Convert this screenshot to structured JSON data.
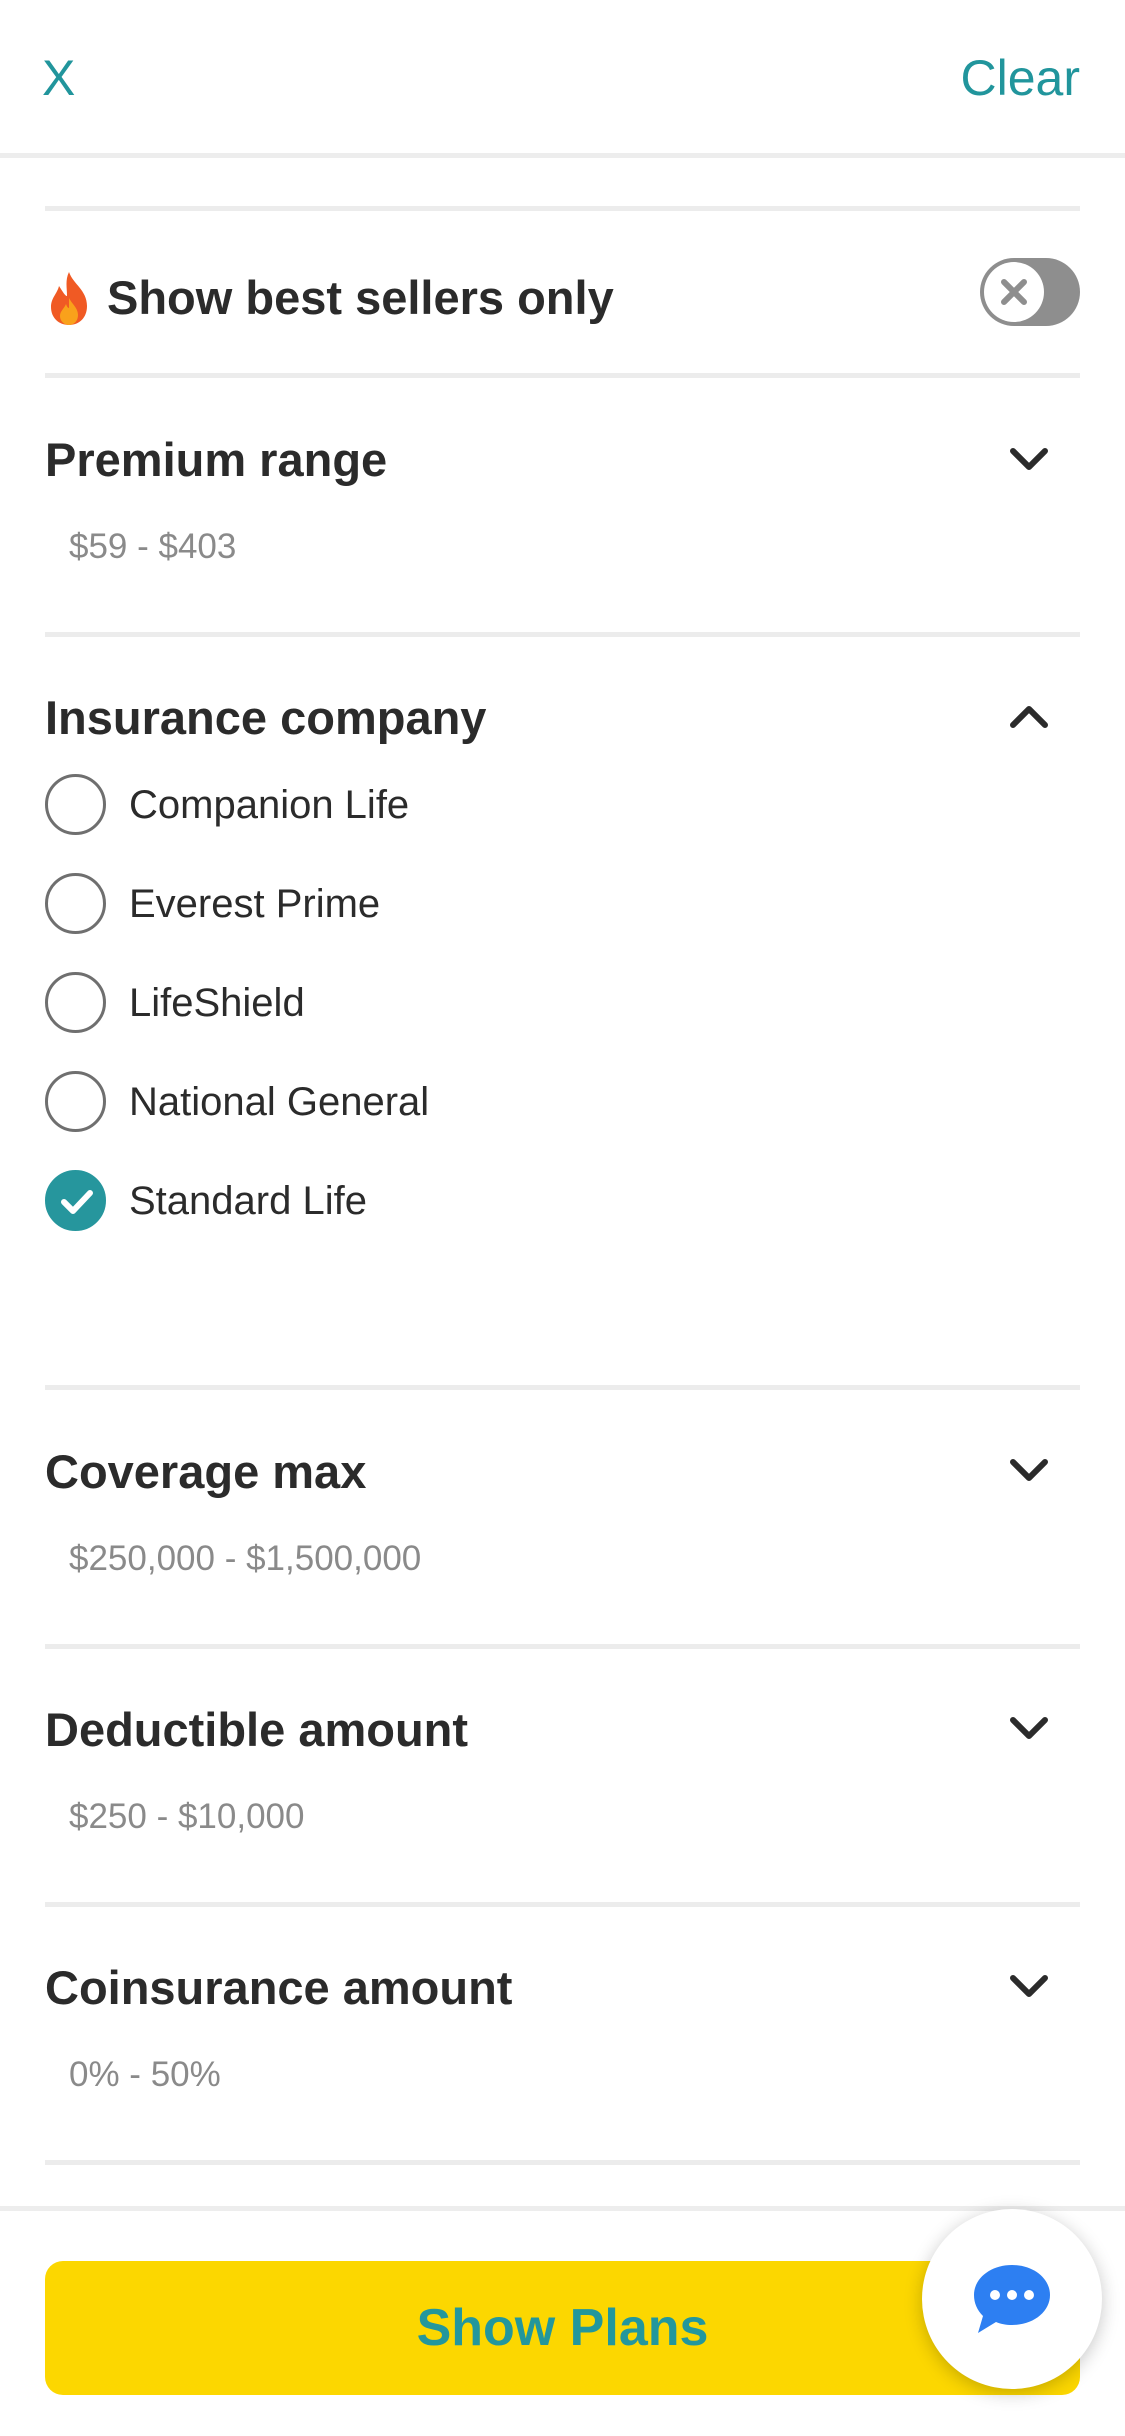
{
  "header": {
    "close_label": "X",
    "clear_label": "Clear"
  },
  "best_sellers": {
    "label": "Show best sellers only",
    "toggle_on": false
  },
  "sections": {
    "premium": {
      "title": "Premium range",
      "summary": "$59 - $403",
      "expanded": false
    },
    "insurance": {
      "title": "Insurance company",
      "expanded": true,
      "options": [
        {
          "label": "Companion Life",
          "checked": false
        },
        {
          "label": "Everest Prime",
          "checked": false
        },
        {
          "label": "LifeShield",
          "checked": false
        },
        {
          "label": "National General",
          "checked": false
        },
        {
          "label": "Standard Life",
          "checked": true
        }
      ]
    },
    "coverage": {
      "title": "Coverage max",
      "summary": "$250,000 - $1,500,000",
      "expanded": false
    },
    "deductible": {
      "title": "Deductible amount",
      "summary": "$250 - $10,000",
      "expanded": false
    },
    "coinsurance": {
      "title": "Coinsurance amount",
      "summary": "0% - 50%",
      "expanded": false
    }
  },
  "footer": {
    "show_plans_label": "Show Plans"
  },
  "icons": {
    "close": "close-icon",
    "flame": "flame-icon",
    "toggle": "toggle-off-icon",
    "chevron_down": "chevron-down-icon",
    "chevron_up": "chevron-up-icon",
    "check": "check-icon",
    "chat": "chat-bubble-icon"
  },
  "colors": {
    "accent": "#21959c",
    "button": "#fcd700",
    "chat": "#2d7ff2",
    "toggle_off": "#8e8e8e"
  }
}
